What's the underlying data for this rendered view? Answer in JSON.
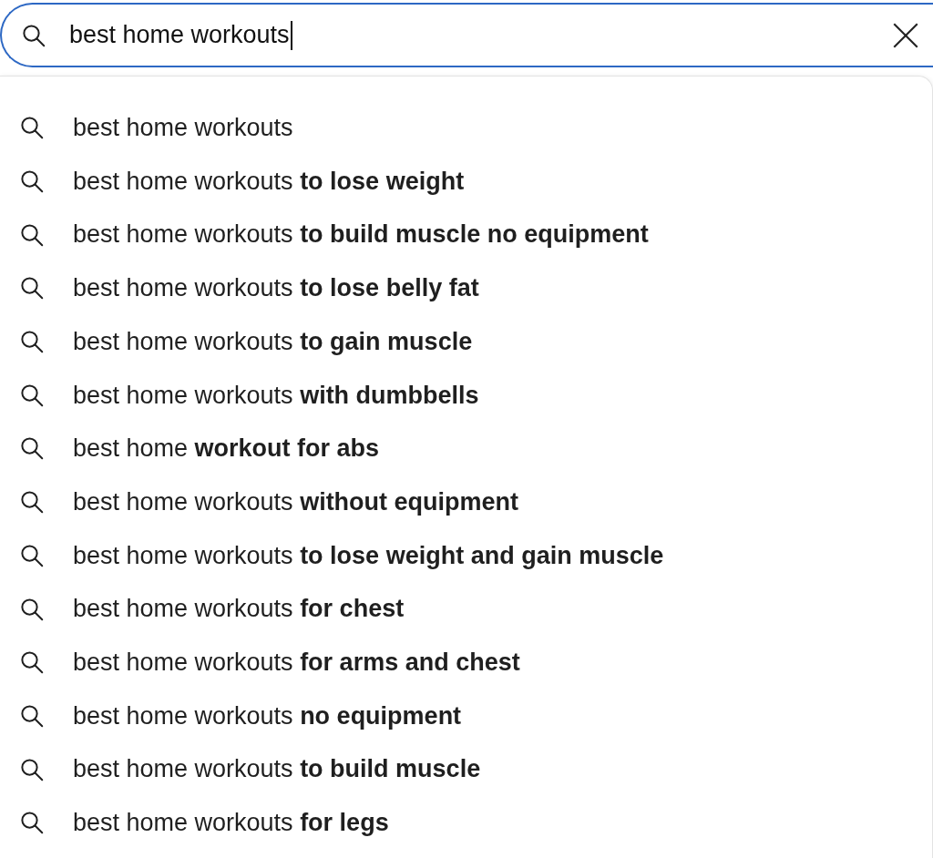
{
  "search": {
    "value": "best home workouts"
  },
  "suggestions": [
    "best home workouts",
    "best home workouts **to lose weight**",
    "best home workouts **to build muscle no equipment**",
    "best home workouts **to lose belly fat**",
    "best home workouts **to gain muscle**",
    "best home workouts **with dumbbells**",
    "best home **workout for abs**",
    "best home workouts **without equipment**",
    "best home workouts **to lose weight and gain muscle**",
    "best home workouts **for chest**",
    "best home workouts **for arms and chest**",
    "best home workouts **no equipment**",
    "best home workouts **to build muscle**",
    "best home workouts **for legs**"
  ]
}
